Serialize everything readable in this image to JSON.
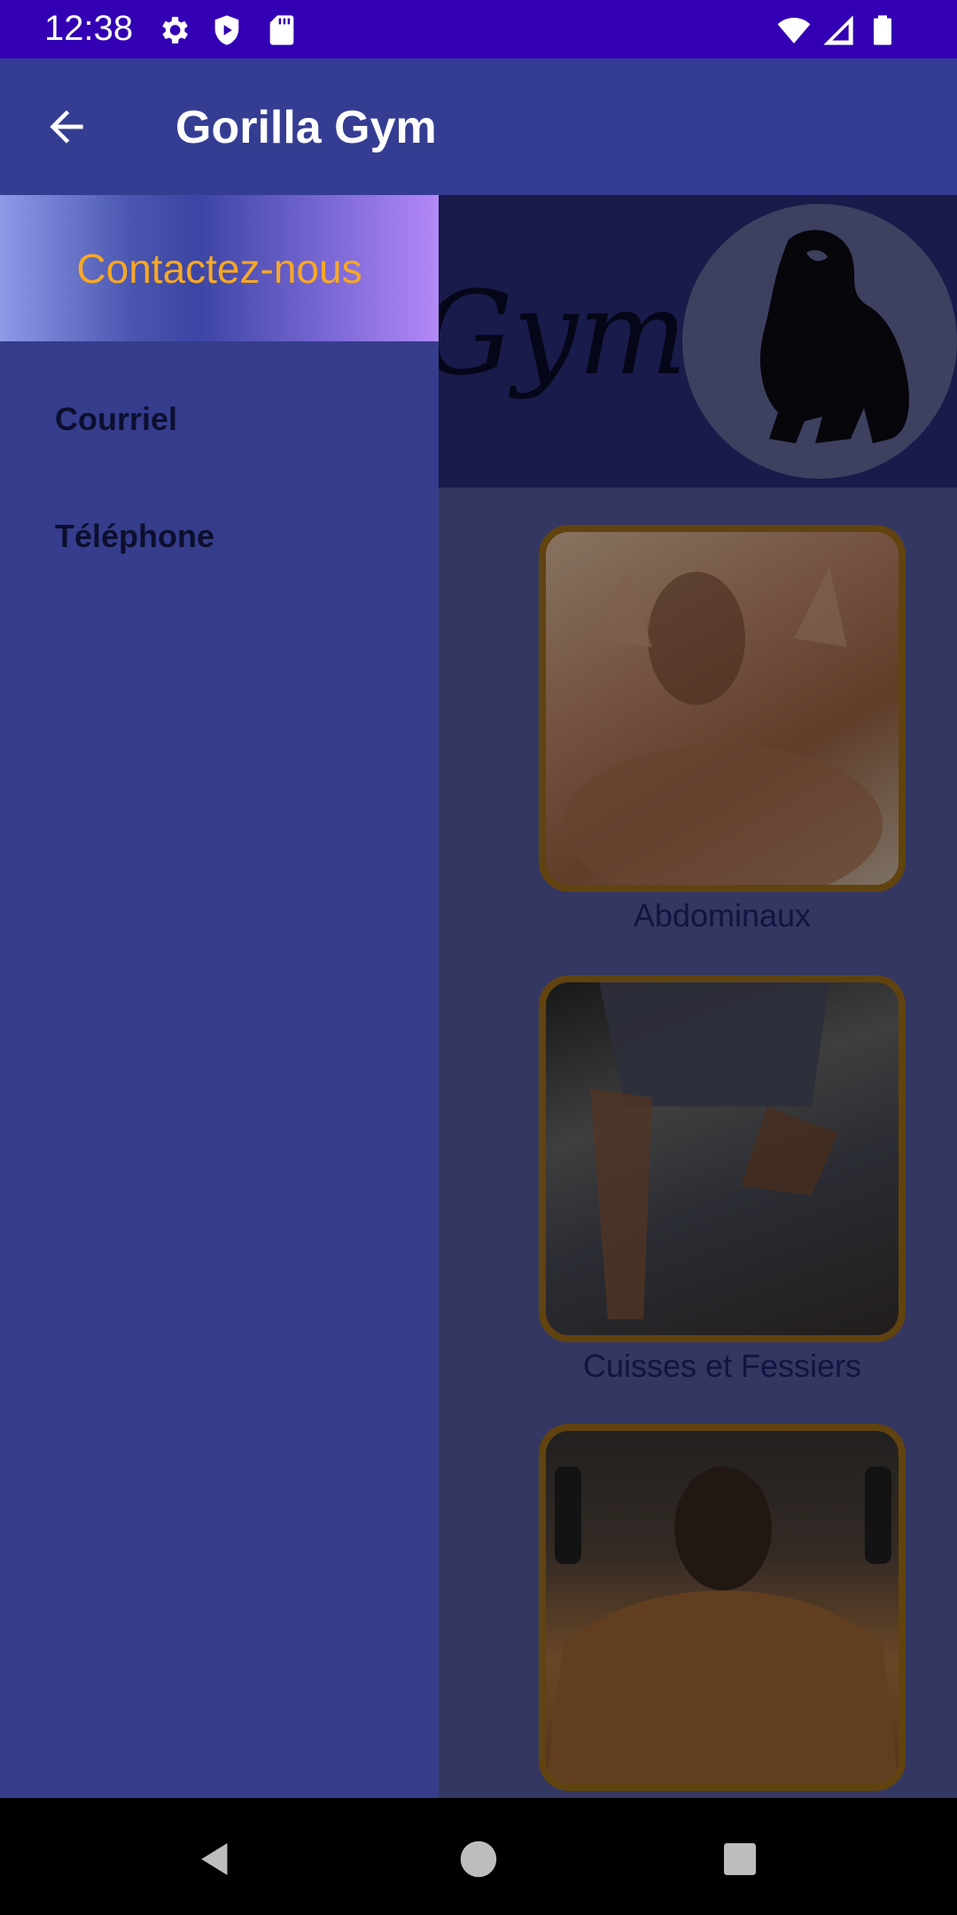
{
  "status_bar": {
    "time": "12:38",
    "left_icons": [
      "settings-icon",
      "play-protect-icon",
      "sd-card-icon"
    ],
    "right_icons": [
      "wifi-icon",
      "cell-signal-icon",
      "battery-icon"
    ]
  },
  "app_bar": {
    "title": "Gorilla Gym",
    "back_icon": "arrow-left-icon"
  },
  "banner": {
    "text": "Gym",
    "logo": "gorilla-logo"
  },
  "categories": [
    {
      "label": "Abdominaux"
    },
    {
      "label": "Cuisses et Fessiers"
    },
    {
      "label": ""
    }
  ],
  "drawer": {
    "header": "Contactez-nous",
    "items": [
      {
        "label": "Courriel"
      },
      {
        "label": "Téléphone"
      }
    ]
  },
  "colors": {
    "status_bar": "#3300b3",
    "app_bar": "#353d93",
    "drawer": "#353d8c",
    "accent_orange": "#f7a825",
    "tile_border": "#a8741d"
  },
  "nav_bar": {
    "icons": [
      "back-triangle-icon",
      "home-circle-icon",
      "recents-square-icon"
    ]
  }
}
